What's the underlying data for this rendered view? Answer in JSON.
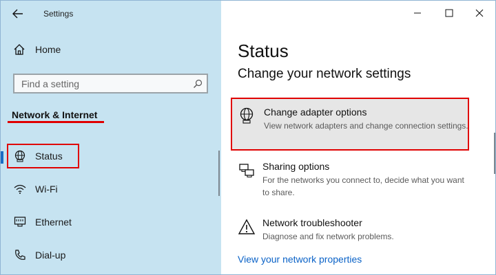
{
  "window": {
    "title": "Settings"
  },
  "sidebar": {
    "home_label": "Home",
    "search_placeholder": "Find a setting",
    "section_title": "Network & Internet",
    "items": [
      {
        "label": "Status",
        "icon": "globe-icon",
        "selected": true
      },
      {
        "label": "Wi-Fi",
        "icon": "wifi-icon"
      },
      {
        "label": "Ethernet",
        "icon": "ethernet-icon"
      },
      {
        "label": "Dial-up",
        "icon": "phone-icon"
      }
    ]
  },
  "main": {
    "title": "Status",
    "subtitle": "Change your network settings",
    "options": [
      {
        "title": "Change adapter options",
        "desc": "View network adapters and change connection settings.",
        "icon": "adapter-icon",
        "highlighted": true
      },
      {
        "title": "Sharing options",
        "desc": "For the networks you connect to, decide what you want to share.",
        "icon": "sharing-icon"
      },
      {
        "title": "Network troubleshooter",
        "desc": "Diagnose and fix network problems.",
        "icon": "warning-icon"
      }
    ],
    "link": "View your network properties"
  },
  "colors": {
    "sidebar_bg": "#c6e3f1",
    "accent": "#1a6cc4",
    "highlight": "#e00000",
    "link": "#0a62c7"
  }
}
